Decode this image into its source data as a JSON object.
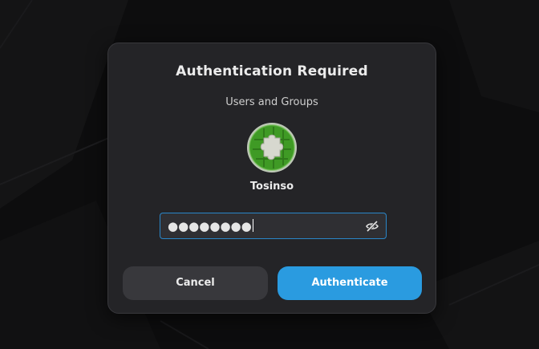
{
  "dialog": {
    "title": "Authentication Required",
    "subtitle": "Users and Groups",
    "user": {
      "name": "Tosinso",
      "avatar_icon": "puzzle-piece-avatar-icon"
    },
    "password": {
      "masked_value": "●●●●●●●●",
      "reveal_icon": "eye-slash-icon"
    },
    "buttons": {
      "cancel_label": "Cancel",
      "authenticate_label": "Authenticate"
    }
  },
  "colors": {
    "dialog_bg": "#242427",
    "accent": "#2a9be0",
    "focus_border": "#2a86c9",
    "cancel_bg": "#38383c",
    "avatar_green": "#4aa82a"
  }
}
